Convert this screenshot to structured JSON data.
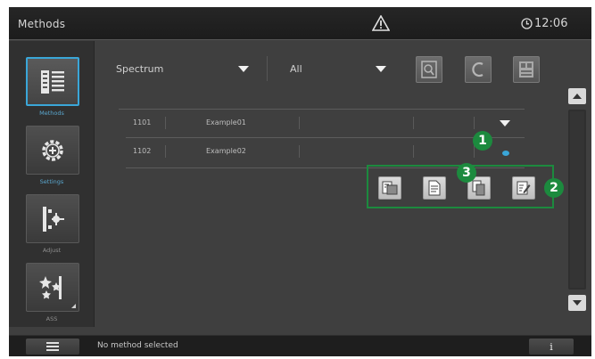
{
  "topbar": {
    "title": "Methods",
    "warning_icon": "warning-triangle-icon",
    "clock_icon": "clock-icon",
    "time": "12:06"
  },
  "sidebar": {
    "items": [
      {
        "label": "Methods",
        "icon": "method-list-icon",
        "active": true
      },
      {
        "label": "Settings",
        "icon": "settings-gear-icon",
        "active": false
      },
      {
        "label": "Adjust",
        "icon": "adjust-icon",
        "active": false
      },
      {
        "label": "ASS",
        "icon": "sparkle-icon",
        "active": false
      }
    ]
  },
  "filters": {
    "type_value": "Spectrum",
    "group_value": "All",
    "tools": [
      "search-icon",
      "reset-icon",
      "export-icon"
    ]
  },
  "methods": {
    "rows": [
      {
        "number": "1101",
        "name": "Example01"
      },
      {
        "number": "1102",
        "name": "Example02"
      }
    ]
  },
  "actions": {
    "buttons": [
      "open-icon",
      "new-method-icon",
      "copy-icon",
      "edit-icon"
    ]
  },
  "callouts": [
    "1",
    "2",
    "3"
  ],
  "statusbar": {
    "status": "No method selected",
    "info": "i",
    "menu_icon": "hamburger-menu-icon"
  },
  "colors": {
    "background": "#3f3f3f",
    "accent": "#3aa6d8",
    "callout": "#1c8a3e"
  }
}
